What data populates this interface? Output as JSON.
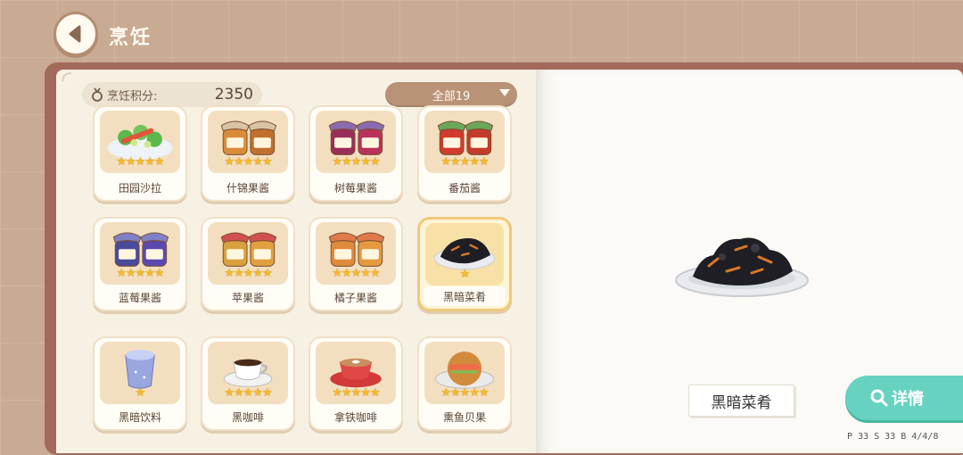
{
  "header": {
    "title": "烹饪",
    "back_icon": "back-arrow-icon"
  },
  "score": {
    "label": "烹饪积分:",
    "value": "2350",
    "icon": "medal-icon"
  },
  "filter": {
    "label": "全部19",
    "icon": "dropdown-triangle-icon"
  },
  "recipes": [
    {
      "name": "田园沙拉",
      "stars": "★★★★★",
      "selected": false
    },
    {
      "name": "什锦果酱",
      "stars": "★★★★★",
      "selected": false
    },
    {
      "name": "树莓果酱",
      "stars": "★★★★★",
      "selected": false
    },
    {
      "name": "番茄酱",
      "stars": "★★★★★",
      "selected": false
    },
    {
      "name": "蓝莓果酱",
      "stars": "★★★★★",
      "selected": false
    },
    {
      "name": "苹果酱",
      "stars": "★★★★★",
      "selected": false
    },
    {
      "name": "橘子果酱",
      "stars": "★★★★★",
      "selected": false
    },
    {
      "name": "黑暗菜肴",
      "stars": "★",
      "selected": true
    },
    {
      "name": "黑暗饮料",
      "stars": "★",
      "selected": false
    },
    {
      "name": "黑咖啡",
      "stars": "★★★★★",
      "selected": false
    },
    {
      "name": "拿铁咖啡",
      "stars": "★★★★★",
      "selected": false
    },
    {
      "name": "熏鱼贝果",
      "stars": "★★★★★",
      "selected": false
    }
  ],
  "detail": {
    "dish_name": "黑暗菜肴",
    "button_label": "详情",
    "button_icon": "search-icon"
  },
  "version_text": "P 33  S 33  B 4/4/8",
  "colors": {
    "accent_teal": "#67d2c0",
    "star": "#f5b92a",
    "book_cover": "#a36a5b"
  }
}
